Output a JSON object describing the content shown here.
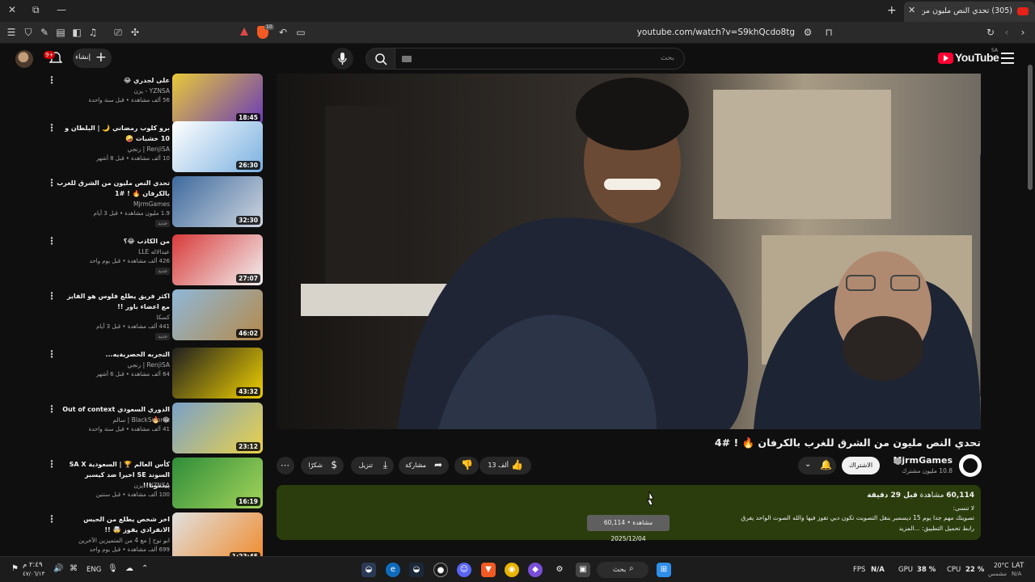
{
  "browser": {
    "tab_title": "(305) تحدي النص مليون من الش",
    "url": "youtube.com/watch?v=S9khQcdo8tg",
    "shield_count": "10"
  },
  "youtube": {
    "logo": "YouTube",
    "logo_country": "SA",
    "search_placeholder": "بحث",
    "create_label": "إنشاء",
    "notification_count": "9+"
  },
  "video": {
    "title": "تحدي النص مليون من الشرق للغرب بالكرفان 🔥 ! #4",
    "channel": "MjrmGames",
    "subscribers": "10.8 مليون مشترك",
    "subscribe_label": "الاشتراك",
    "likes": "13 ألف",
    "share_label": "مشاركة",
    "download_label": "تنزيل",
    "thanks_label": "شكرًا",
    "more_label": "⋯",
    "views": "60,114",
    "views_label": "مشاهدة",
    "time_ago": "قبل 29 دقيقة",
    "desc_line2": "لا تنسى:",
    "desc_line3": "تصويتك مهم جدا يوم 15 ديسمبر بنقل التصويت تكون دبي تفوز فيها والله الصوت الواحد يفرق",
    "desc_line4": "رابط تحميل التطبيق: ...المزيد",
    "tooltip": "60,114 مشاهدة • 2025/12/04"
  },
  "recommendations": [
    {
      "title": "على لجدري 😂",
      "channel": "YZNSA - يزن",
      "stats": "56 ألف مشاهدة • قبل سنة واحدة",
      "duration": "18:45",
      "new": ""
    },
    {
      "title": "برو كلوب رمضاني 🌙 | البلطان و 10 خشبات 🤪",
      "channel": "RenjiSA | رنجي",
      "stats": "10 ألف مشاهدة • قبل 8 أشهر",
      "duration": "26:30",
      "new": ""
    },
    {
      "title": "تحدي النص مليون من الشرق للغرب بالكرفان 🔥 ! #1",
      "channel": "MjrmGames",
      "stats": "1.9 مليون مشاهدة • قبل 3 أيام",
      "duration": "32:30",
      "new": "جديد"
    },
    {
      "title": "من الكاذب 😂؟",
      "channel": "عبدالاله LLE",
      "stats": "426 ألف مشاهدة • قبل يوم واحد",
      "duration": "27:07",
      "new": "جديد"
    },
    {
      "title": "اكثر فريق يطلع فلوس هو الفايز مع اعضاء باور !!",
      "channel": "كسكا",
      "stats": "441 ألف مشاهدة • قبل 3 أيام",
      "duration": "46:02",
      "new": "جديد"
    },
    {
      "title": "التجربه الحصريةيه...",
      "channel": "RenjiSA | رنجي",
      "stats": "64 ألف مشاهدة • قبل 6 أشهر",
      "duration": "43:32",
      "new": ""
    },
    {
      "title": "الدوري السعودي Out of context 😂 🔥",
      "channel": "BlackSwordz | سالم",
      "stats": "41 ألف مشاهدة • قبل سنة واحدة",
      "duration": "23:12",
      "new": ""
    },
    {
      "title": "كأس العالم 🏆 | السعودية SA X السوند SE اخيرا ضد كيسبر بينمونا!!",
      "channel": "YZNSA - يزن",
      "stats": "100 ألف مشاهدة • قبل سنتين",
      "duration": "16:19",
      "new": ""
    },
    {
      "title": "اخر شخص يطلع من الحبس الانفرادي يفوز 🤯 !!",
      "channel": "ابو نوح | مع 4 من المتميزين الآخرين",
      "stats": "699 ألف مشاهدة • قبل يوم واحد",
      "duration": "1:23:45",
      "new": ""
    }
  ],
  "taskbar": {
    "fps_label": "FPS",
    "fps_value": "N/A",
    "gpu_label": "GPU",
    "gpu_value": "38 %",
    "cpu_label": "CPU",
    "cpu_value": "22 %",
    "search_label": "بحث",
    "lang": "ENG",
    "temp": "20°C",
    "temp_label": "مشمس",
    "kbd_lang": "LAT",
    "kbd_sub": "N/A",
    "time": "٢:٤٩ م",
    "date": "٤٧/٠٦/١٣"
  }
}
